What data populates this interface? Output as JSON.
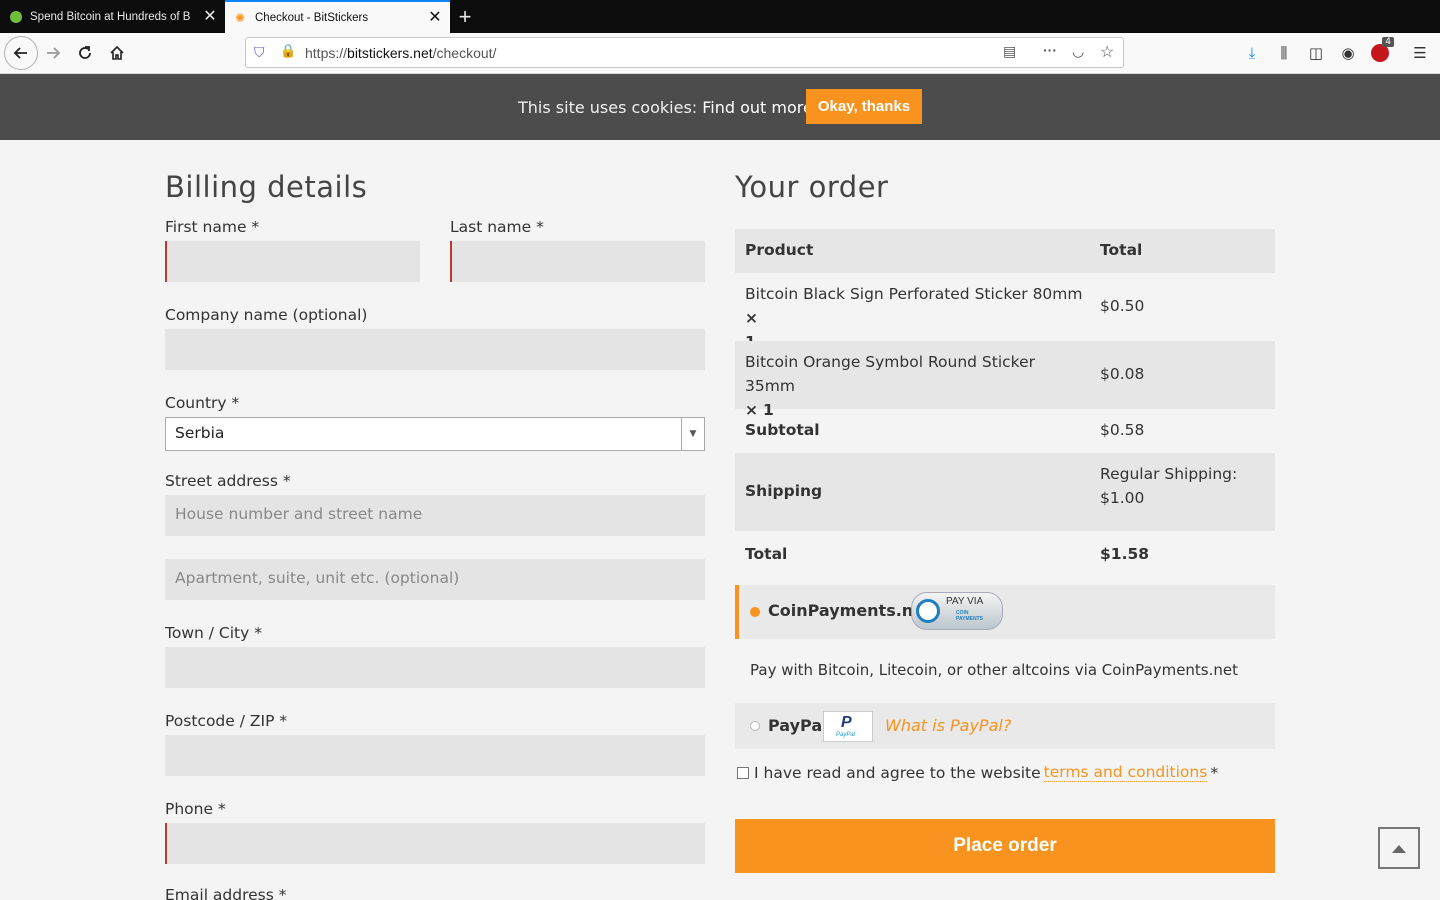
{
  "browser": {
    "tabs": [
      {
        "label": "Spend Bitcoin at Hundreds of B",
        "active": false,
        "favicon_color": "#6fbf3a"
      },
      {
        "label": "Checkout - BitStickers",
        "active": true,
        "favicon_color": "#f7931e"
      }
    ],
    "new_tab_label": "+",
    "url_prefix": "https://",
    "url_domain": "bitstickers.net",
    "url_path": "/checkout/",
    "addon_badge": "4"
  },
  "cookie_bar": {
    "text": "This site uses cookies: ",
    "link": "Find out more.",
    "button": "Okay, thanks"
  },
  "billing": {
    "title": "Billing details",
    "first_name_label": "First name *",
    "last_name_label": "Last name *",
    "company_label": "Company name (optional)",
    "country_label": "Country *",
    "country_value": "Serbia",
    "street_label": "Street address *",
    "street_placeholder": "House number and street name",
    "apartment_placeholder": "Apartment, suite, unit etc. (optional)",
    "city_label": "Town / City *",
    "postcode_label": "Postcode / ZIP *",
    "phone_label": "Phone *",
    "email_label": "Email address *"
  },
  "order": {
    "title": "Your order",
    "col_product": "Product",
    "col_total": "Total",
    "items": [
      {
        "name_line1": "Bitcoin Black Sign Perforated Sticker 80mm ",
        "qty_mark": "×",
        "name_line2": "1",
        "total": "$0.50"
      },
      {
        "name_line1": "Bitcoin Orange Symbol Round Sticker 35mm",
        "qty_mark": "×",
        "name_line2": "1",
        "total": "$0.08"
      }
    ],
    "subtotal_label": "Subtotal",
    "subtotal_value": "$0.58",
    "shipping_label": "Shipping",
    "shipping_line1": "Regular Shipping:",
    "shipping_line2": "$1.00",
    "total_label": "Total",
    "total_value": "$1.58"
  },
  "payment": {
    "coinpayments_label": "CoinPayments.net",
    "coinpayments_badge_line1": "PAY VIA",
    "coinpayments_badge_line2": "COIN PAYMENTS",
    "coinpayments_desc": "Pay with Bitcoin, Litecoin, or other altcoins via CoinPayments.net",
    "paypal_label": "PayPal",
    "paypal_logo_text": "PayPal",
    "what_is_paypal": "What is PayPal?",
    "terms_text": "I have read and agree to the website ",
    "terms_link": "terms and conditions",
    "terms_required": " *",
    "place_order": "Place order"
  },
  "colors": {
    "accent": "#f7931e",
    "required_border": "#c0392b"
  }
}
